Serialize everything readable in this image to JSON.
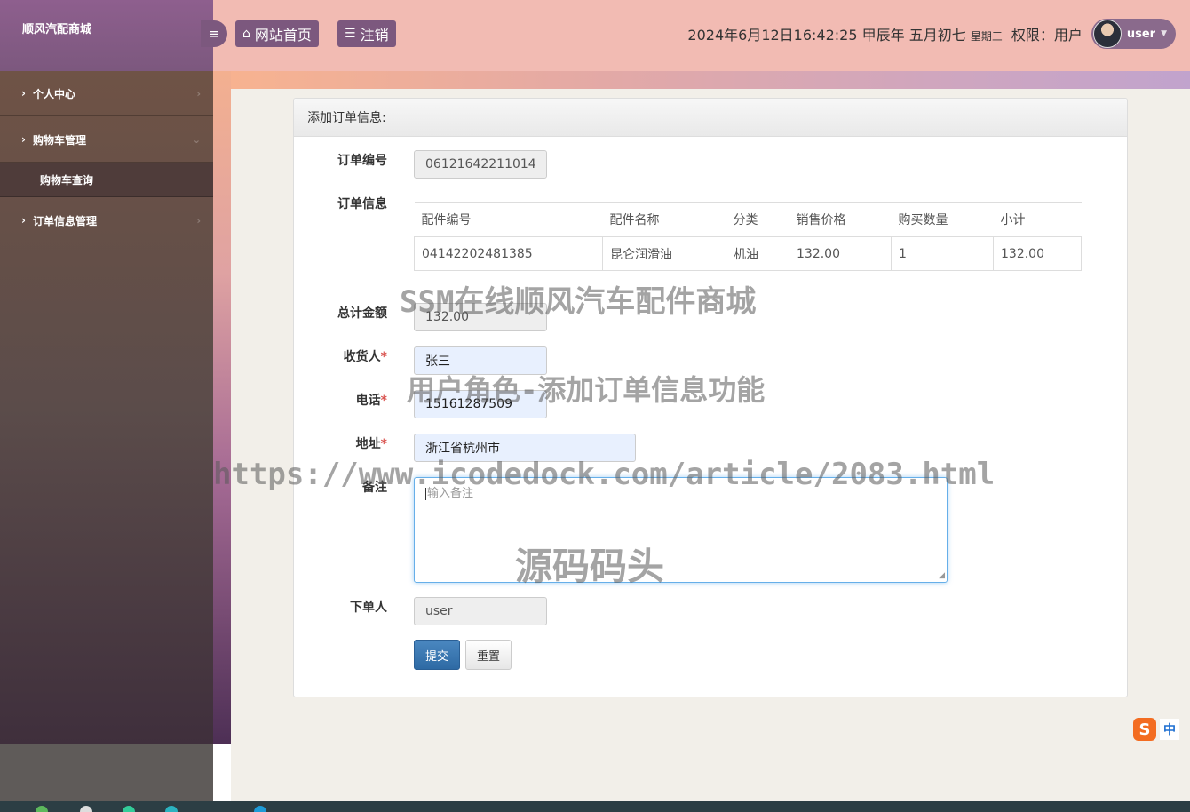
{
  "header": {
    "brand": "顺风汽配商城",
    "menu_icon": "menu-icon",
    "home_label": "网站首页",
    "logout_label": "注销",
    "datetime": "2024年6月12日16:42:25 甲辰年 五月初七",
    "weekday": "星期三",
    "permission": "权限：用户",
    "username": "user"
  },
  "sidebar": {
    "items": [
      {
        "label": "个人中心"
      },
      {
        "label": "购物车管理"
      },
      {
        "label": "订单信息管理"
      }
    ],
    "sub_items": [
      {
        "label": "购物车查询"
      }
    ]
  },
  "panel": {
    "title": "添加订单信息:"
  },
  "form": {
    "order_no_label": "订单编号",
    "order_no": "06121642211014",
    "order_info_label": "订单信息",
    "total_label": "总计金额",
    "total": "132.00",
    "receiver_label": "收货人",
    "receiver": "张三",
    "phone_label": "电话",
    "phone": "15161287509",
    "address_label": "地址",
    "address": "浙江省杭州市",
    "notes_label": "备注",
    "notes_placeholder": "输入备注",
    "buyer_label": "下单人",
    "buyer": "user",
    "required_mark": "*",
    "submit_label": "提交",
    "reset_label": "重置"
  },
  "order_table": {
    "columns": [
      "配件编号",
      "配件名称",
      "分类",
      "销售价格",
      "购买数量",
      "小计"
    ],
    "rows": [
      [
        "04142202481385",
        "昆仑润滑油",
        "机油",
        "132.00",
        "1",
        "132.00"
      ]
    ]
  },
  "watermarks": {
    "line1": "SSM在线顺风汽车配件商城",
    "line2": "用户角色-添加订单信息功能",
    "line3": "https://www.icodedock.com/article/2083.html",
    "line4": "源码码头"
  },
  "ime": {
    "logo": "S",
    "mode": "中"
  },
  "colors": {
    "header_bg": "#f2bbb3",
    "brand_bg": "#7c587e",
    "primary_button": "#2e6aa4",
    "required": "#d9534f"
  }
}
